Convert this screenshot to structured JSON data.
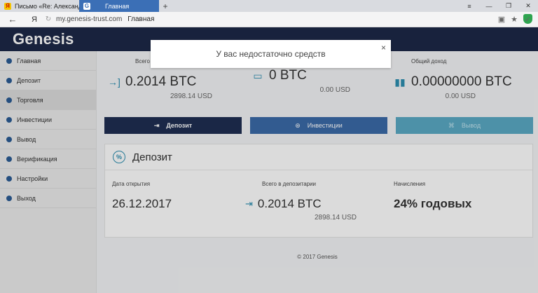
{
  "browser": {
    "tabs": [
      {
        "label": "Письмо «Re: Александр Ко",
        "favicon": "Я",
        "active": false
      },
      {
        "label": "Главная",
        "favicon": "G",
        "active": true
      }
    ],
    "new_tab": "+",
    "window_controls": [
      "≡",
      "—",
      "❐",
      "✕"
    ],
    "back": "←",
    "ya_button": "Я",
    "reload": "↻",
    "url": "my.genesis-trust.com",
    "page_title": "Главная",
    "right_icons": [
      "▣",
      "★"
    ],
    "shield": "✓"
  },
  "app": {
    "logo": "Genesis"
  },
  "sidebar": {
    "items": [
      {
        "label": "Главная"
      },
      {
        "label": "Депозит"
      },
      {
        "label": "Торговля"
      },
      {
        "label": "Инвестиции"
      },
      {
        "label": "Вывод"
      },
      {
        "label": "Верификация"
      },
      {
        "label": "Настройки"
      },
      {
        "label": "Выход"
      }
    ]
  },
  "stats": [
    {
      "label": "Всего в д",
      "value": "0.2014 BTC",
      "usd": "2898.14 USD",
      "icon": "→]"
    },
    {
      "label": "",
      "value": "0 BTC",
      "usd": "0.00 USD",
      "icon": "▭"
    },
    {
      "label": "Общий доход",
      "value": "0.00000000 BTC",
      "usd": "0.00 USD",
      "icon": "▮▮"
    }
  ],
  "buttons": {
    "deposit": "Депозит",
    "invest": "Инвестиции",
    "withdraw": "Вывод"
  },
  "deposit_card": {
    "title": "Депозит",
    "icon": "%",
    "open_date_label": "Дата открытия",
    "open_date": "26.12.2017",
    "total_label": "Всего в депозитарии",
    "total_value": "0.2014 BTC",
    "total_usd": "2898.14 USD",
    "accrual_label": "Начисления",
    "accrual_value": "24% годовых"
  },
  "footer": "© 2017 Genesis",
  "modal": {
    "message": "У вас недостаточно средств",
    "close": "×"
  },
  "colors": {
    "header": "#1c2848",
    "accent": "#2d8fb0",
    "tab_active": "#3b6fb6"
  }
}
